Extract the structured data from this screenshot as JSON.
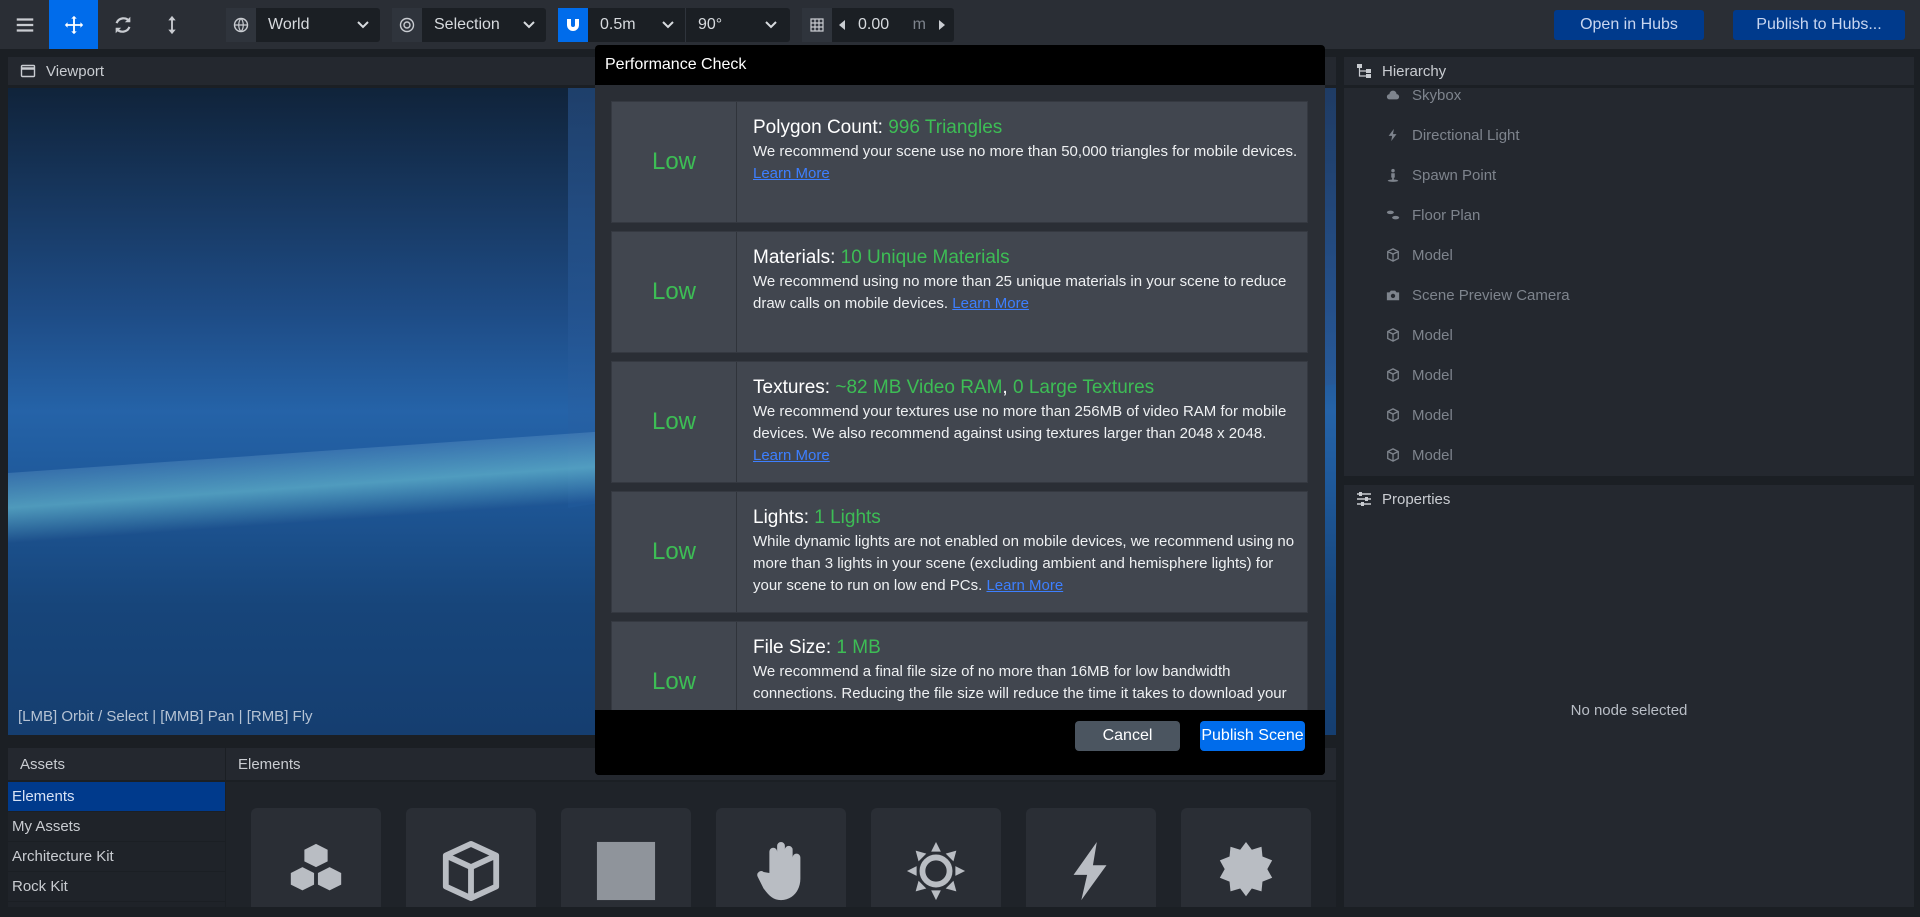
{
  "toolbar": {
    "space_select": "World",
    "pivot_select": "Selection",
    "translation_snap": "0.5m",
    "rotation_snap": "90°",
    "grid_height": "0.00",
    "grid_unit": "m",
    "open_in_hubs": "Open in Hubs",
    "publish_to_hubs": "Publish to Hubs..."
  },
  "viewport": {
    "title": "Viewport",
    "hint": "[LMB] Orbit / Select | [MMB] Pan | [RMB] Fly"
  },
  "hierarchy": {
    "title": "Hierarchy",
    "items": [
      {
        "label": "Skybox",
        "icon": "cloud-icon"
      },
      {
        "label": "Directional Light",
        "icon": "bolt-icon"
      },
      {
        "label": "Spawn Point",
        "icon": "street-view-icon"
      },
      {
        "label": "Floor Plan",
        "icon": "shoe-prints-icon"
      },
      {
        "label": "Model",
        "icon": "cube-icon"
      },
      {
        "label": "Scene Preview Camera",
        "icon": "camera-icon"
      },
      {
        "label": "Model",
        "icon": "cube-icon"
      },
      {
        "label": "Model",
        "icon": "cube-icon"
      },
      {
        "label": "Model",
        "icon": "cube-icon"
      },
      {
        "label": "Model",
        "icon": "cube-icon"
      }
    ]
  },
  "properties": {
    "title": "Properties",
    "empty_text": "No node selected"
  },
  "assets": {
    "title": "Assets",
    "items": [
      "Elements",
      "My Assets",
      "Architecture Kit",
      "Rock Kit"
    ],
    "selected": "Elements"
  },
  "elements": {
    "title": "Elements",
    "cards": [
      "cubes-icon",
      "cube-icon",
      "square-icon",
      "hand-icon",
      "sun-icon",
      "bolt-icon",
      "certificate-icon"
    ]
  },
  "modal": {
    "title": "Performance Check",
    "checks": [
      {
        "rating": "Low",
        "label": "Polygon Count:",
        "value1": "996 Triangles",
        "description": "We recommend your scene use no more than 50,000 triangles for mobile devices.",
        "link": "Learn More"
      },
      {
        "rating": "Low",
        "label": "Materials:",
        "value1": "10 Unique Materials",
        "description": "We recommend using no more than 25 unique materials in your scene to reduce draw calls on mobile devices.",
        "link": "Learn More"
      },
      {
        "rating": "Low",
        "label": "Textures:",
        "value1": "~82 MB Video RAM",
        "separator": ",",
        "value2": "0 Large Textures",
        "description": "We recommend your textures use no more than 256MB of video RAM for mobile devices. We also recommend against using textures larger than 2048 x 2048.",
        "link": "Learn More"
      },
      {
        "rating": "Low",
        "label": "Lights:",
        "value1": "1 Lights",
        "description": "While dynamic lights are not enabled on mobile devices, we recommend using no more than 3 lights in your scene (excluding ambient and hemisphere lights) for your scene to run on low end PCs.",
        "link": "Learn More"
      },
      {
        "rating": "Low",
        "label": "File Size:",
        "value1": "1 MB",
        "description": "We recommend a final file size of no more than 16MB for low bandwidth connections. Reducing the file size will reduce the time it takes to download your"
      }
    ],
    "cancel": "Cancel",
    "publish": "Publish Scene"
  },
  "colors": {
    "accent": "#006ceb",
    "good": "#3dbd55",
    "link": "#3d7fff",
    "panel": "#24282f",
    "background": "#1b1f24"
  }
}
